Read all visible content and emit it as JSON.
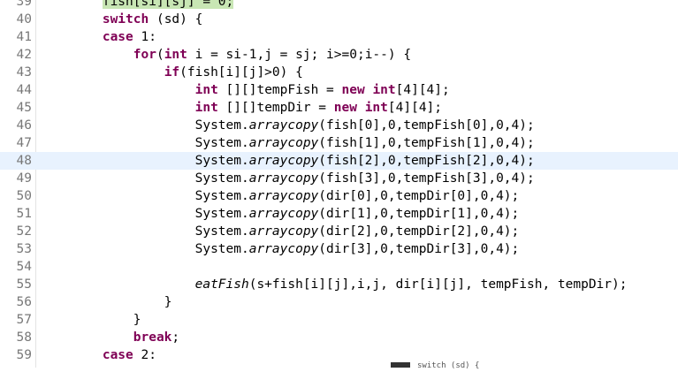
{
  "editor": {
    "lines": [
      {
        "num": "39",
        "indent": "        ",
        "parts": [
          {
            "t": "fish[si][sj] = 0;",
            "c": "green"
          }
        ]
      },
      {
        "num": "40",
        "indent": "        ",
        "parts": [
          {
            "t": "switch",
            "c": "kw"
          },
          {
            "t": " (sd) {"
          }
        ]
      },
      {
        "num": "41",
        "indent": "        ",
        "parts": [
          {
            "t": "case",
            "c": "kw"
          },
          {
            "t": " 1:"
          }
        ]
      },
      {
        "num": "42",
        "indent": "            ",
        "parts": [
          {
            "t": "for",
            "c": "kw"
          },
          {
            "t": "("
          },
          {
            "t": "int",
            "c": "kw"
          },
          {
            "t": " i = si-1,j = sj; i>=0;i--) {"
          }
        ]
      },
      {
        "num": "43",
        "indent": "                ",
        "parts": [
          {
            "t": "if",
            "c": "kw"
          },
          {
            "t": "(fish[i][j]>0) {"
          }
        ]
      },
      {
        "num": "44",
        "indent": "                    ",
        "parts": [
          {
            "t": "int",
            "c": "kw"
          },
          {
            "t": " [][]tempFish = "
          },
          {
            "t": "new",
            "c": "kw"
          },
          {
            "t": " "
          },
          {
            "t": "int",
            "c": "kw"
          },
          {
            "t": "[4][4];"
          }
        ]
      },
      {
        "num": "45",
        "indent": "                    ",
        "parts": [
          {
            "t": "int",
            "c": "kw"
          },
          {
            "t": " [][]tempDir = "
          },
          {
            "t": "new",
            "c": "kw"
          },
          {
            "t": " "
          },
          {
            "t": "int",
            "c": "kw"
          },
          {
            "t": "[4][4];"
          }
        ]
      },
      {
        "num": "46",
        "indent": "                    ",
        "parts": [
          {
            "t": "System."
          },
          {
            "t": "arraycopy",
            "c": "it"
          },
          {
            "t": "(fish[0],0,tempFish[0],0,4);"
          }
        ]
      },
      {
        "num": "47",
        "indent": "                    ",
        "parts": [
          {
            "t": "System."
          },
          {
            "t": "arraycopy",
            "c": "it"
          },
          {
            "t": "(fish[1],0,tempFish[1],0,4);"
          }
        ]
      },
      {
        "num": "48",
        "indent": "                    ",
        "highlight": true,
        "parts": [
          {
            "t": "System."
          },
          {
            "t": "arraycopy",
            "c": "it"
          },
          {
            "t": "(fish[2],0,tempFish[2],0,4);"
          }
        ]
      },
      {
        "num": "49",
        "indent": "                    ",
        "parts": [
          {
            "t": "System."
          },
          {
            "t": "arraycopy",
            "c": "it"
          },
          {
            "t": "(fish[3],0,tempFish[3],0,4);"
          }
        ]
      },
      {
        "num": "50",
        "indent": "                    ",
        "parts": [
          {
            "t": "System."
          },
          {
            "t": "arraycopy",
            "c": "it"
          },
          {
            "t": "(dir[0],0,tempDir[0],0,4);"
          }
        ]
      },
      {
        "num": "51",
        "indent": "                    ",
        "parts": [
          {
            "t": "System."
          },
          {
            "t": "arraycopy",
            "c": "it"
          },
          {
            "t": "(dir[1],0,tempDir[1],0,4);"
          }
        ]
      },
      {
        "num": "52",
        "indent": "                    ",
        "parts": [
          {
            "t": "System."
          },
          {
            "t": "arraycopy",
            "c": "it"
          },
          {
            "t": "(dir[2],0,tempDir[2],0,4);"
          }
        ]
      },
      {
        "num": "53",
        "indent": "                    ",
        "parts": [
          {
            "t": "System."
          },
          {
            "t": "arraycopy",
            "c": "it"
          },
          {
            "t": "(dir[3],0,tempDir[3],0,4);"
          }
        ]
      },
      {
        "num": "54",
        "indent": "",
        "parts": []
      },
      {
        "num": "55",
        "indent": "                    ",
        "parts": [
          {
            "t": "eatFish",
            "c": "it"
          },
          {
            "t": "(s+fish[i][j],i,j, dir[i][j], tempFish, tempDir);"
          }
        ]
      },
      {
        "num": "56",
        "indent": "                ",
        "parts": [
          {
            "t": "}"
          }
        ]
      },
      {
        "num": "57",
        "indent": "            ",
        "parts": [
          {
            "t": "}"
          }
        ]
      },
      {
        "num": "58",
        "indent": "            ",
        "parts": [
          {
            "t": "break",
            "c": "kw"
          },
          {
            "t": ";"
          }
        ]
      },
      {
        "num": "59",
        "indent": "        ",
        "parts": [
          {
            "t": "case",
            "c": "kw"
          },
          {
            "t": " 2:"
          }
        ]
      }
    ],
    "hover_popup_text": "switch (sd) {"
  },
  "colors": {
    "keyword": "#7f0055",
    "line_number": "#787878",
    "current_line_highlight": "#e8f2fe",
    "match_highlight": "#c8e6b4"
  }
}
